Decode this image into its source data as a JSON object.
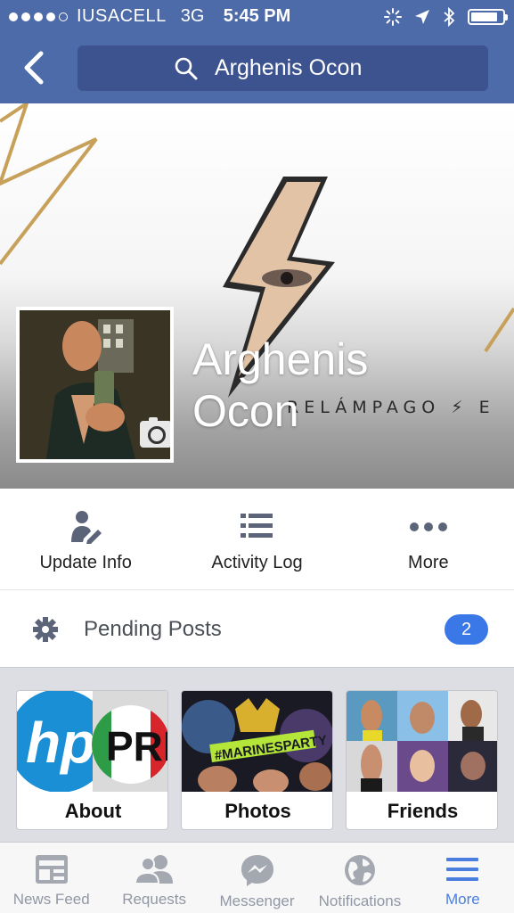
{
  "status_bar": {
    "carrier": "IUSACELL",
    "network": "3G",
    "time": "5:45 PM",
    "signal_bars_filled": 4,
    "signal_bars_total": 5,
    "battery_level": 0.85
  },
  "nav": {
    "back_icon": "chevron-left-icon",
    "search_icon": "search-icon",
    "search_value": "Arghenis Ocon"
  },
  "cover": {
    "brand_text": "RELÁMPAGO ⚡ E"
  },
  "profile": {
    "name": "Arghenis Ocon"
  },
  "actions": [
    {
      "label": "Update Info",
      "icon": "edit-profile-icon"
    },
    {
      "label": "Activity Log",
      "icon": "list-icon"
    },
    {
      "label": "More",
      "icon": "more-dots-icon"
    }
  ],
  "pending": {
    "label": "Pending Posts",
    "count": "2",
    "icon": "gear-icon"
  },
  "tiles": [
    {
      "label": "About"
    },
    {
      "label": "Photos"
    },
    {
      "label": "Friends"
    }
  ],
  "tabs": [
    {
      "label": "News Feed",
      "icon": "news-feed-icon"
    },
    {
      "label": "Requests",
      "icon": "friend-requests-icon"
    },
    {
      "label": "Messenger",
      "icon": "messenger-icon"
    },
    {
      "label": "Notifications",
      "icon": "globe-icon"
    },
    {
      "label": "More",
      "icon": "menu-icon",
      "active": true
    }
  ],
  "colors": {
    "brand_blue": "#4e6ba9",
    "search_bg": "#3c5390",
    "badge_blue": "#3b78e7",
    "active_tab": "#4a7fe0"
  }
}
